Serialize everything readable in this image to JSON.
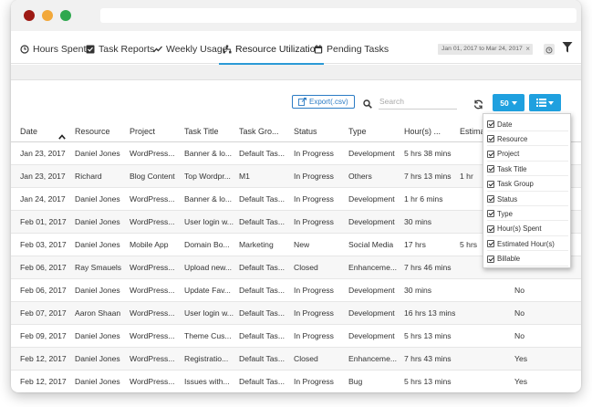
{
  "tabs": [
    {
      "label": "Hours Spent",
      "icon": "clock-icon"
    },
    {
      "label": "Task Reports",
      "icon": "checkbox-icon"
    },
    {
      "label": "Weekly Usage",
      "icon": "line-chart-icon"
    },
    {
      "label": "Resource Utilization",
      "icon": "sitemap-icon",
      "active": true
    },
    {
      "label": "Pending Tasks",
      "icon": "calendar-icon"
    }
  ],
  "date_range": "Jan 01, 2017 to Mar 24, 2017",
  "date_clear": "×",
  "toolbar": {
    "export_label": "Export(.csv)",
    "search_placeholder": "Search",
    "page_size": "50"
  },
  "colors": {
    "accent": "#1fa0df",
    "tab_underline": "#2b9ad6",
    "export_border": "#2b7bc4"
  },
  "table": {
    "columns": [
      "Date",
      "Resource",
      "Project",
      "Task Title",
      "Task Gro...",
      "Status",
      "Type",
      "Hour(s) ...",
      "Estima"
    ],
    "rows": [
      [
        "Jan 23, 2017",
        "Daniel Jones",
        "WordPress...",
        "Banner & lo...",
        "Default Tas...",
        "In Progress",
        "Development",
        "5 hrs 38 mins",
        "",
        ""
      ],
      [
        "Jan 23, 2017",
        "Richard",
        "Blog Content",
        "Top Wordpr...",
        "M1",
        "In Progress",
        "Others",
        "7 hrs 13 mins",
        "1 hr",
        ""
      ],
      [
        "Jan 24, 2017",
        "Daniel Jones",
        "WordPress...",
        "Banner & lo...",
        "Default Tas...",
        "In Progress",
        "Development",
        "1 hr 6 mins",
        "",
        ""
      ],
      [
        "Feb 01, 2017",
        "Daniel Jones",
        "WordPress...",
        "User login w...",
        "Default Tas...",
        "In Progress",
        "Development",
        "30 mins",
        "",
        ""
      ],
      [
        "Feb 03, 2017",
        "Daniel Jones",
        "Mobile App",
        "Domain Bo...",
        "Marketing",
        "New",
        "Social Media",
        "17 hrs",
        "5 hrs",
        ""
      ],
      [
        "Feb 06, 2017",
        "Ray Smauels",
        "WordPress...",
        "Upload new...",
        "Default Tas...",
        "Closed",
        "Enhanceme...",
        "7 hrs 46 mins",
        "",
        ""
      ],
      [
        "Feb 06, 2017",
        "Daniel Jones",
        "WordPress...",
        "Update Fav...",
        "Default Tas...",
        "In Progress",
        "Development",
        "30 mins",
        "",
        "No"
      ],
      [
        "Feb 07, 2017",
        "Aaron Shaan",
        "WordPress...",
        "User login w...",
        "Default Tas...",
        "In Progress",
        "Development",
        "16 hrs 13 mins",
        "",
        "No"
      ],
      [
        "Feb 09, 2017",
        "Daniel Jones",
        "WordPress...",
        "Theme Cus...",
        "Default Tas...",
        "In Progress",
        "Development",
        "5 hrs 13 mins",
        "",
        "No"
      ],
      [
        "Feb 12, 2017",
        "Daniel Jones",
        "WordPress...",
        "Registratio...",
        "Default Tas...",
        "Closed",
        "Enhanceme...",
        "7 hrs 43 mins",
        "",
        "Yes"
      ],
      [
        "Feb 12, 2017",
        "Daniel Jones",
        "WordPress...",
        "Issues with...",
        "Default Tas...",
        "In Progress",
        "Bug",
        "5 hrs 13 mins",
        "",
        "Yes"
      ]
    ]
  },
  "column_menu": [
    {
      "label": "Date",
      "checked": true
    },
    {
      "label": "Resource",
      "checked": true
    },
    {
      "label": "Project",
      "checked": true
    },
    {
      "label": "Task Title",
      "checked": true
    },
    {
      "label": "Task Group",
      "checked": true
    },
    {
      "label": "Status",
      "checked": true
    },
    {
      "label": "Type",
      "checked": true
    },
    {
      "label": "Hour(s) Spent",
      "checked": true
    },
    {
      "label": "Estimated Hour(s)",
      "checked": true
    },
    {
      "label": "Billable",
      "checked": true
    }
  ]
}
